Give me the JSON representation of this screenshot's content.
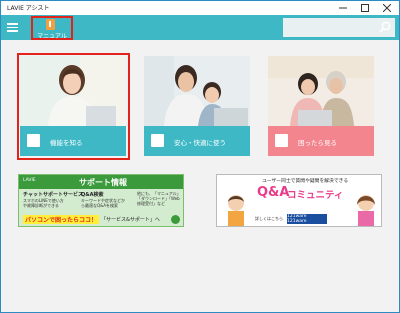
{
  "window": {
    "title": "LAVIE アシスト"
  },
  "header": {
    "manual_label": "マニュアル"
  },
  "tiles": [
    {
      "label": "機能を知る"
    },
    {
      "label": "安心・快適に使う"
    },
    {
      "label": "困ったら見る"
    }
  ],
  "banner_support": {
    "logo": "LAVIE",
    "title": "サポート情報",
    "col1_title": "チャットサポートサービス",
    "col1_text": "スマホのLINEで使い方や故障診断ができる",
    "col2_title": "Q&A検索",
    "col2_text": "キーワードや症状などから最適なQ&Aを検索",
    "col3_text": "他にも、「マニュアル」「ダウンロード」「Web修理受付」など",
    "footer_highlight": "パソコンで困ったらココ！",
    "footer_link": "「サービス&サポート」へ"
  },
  "banner_community": {
    "tagline": "ユーザー同士で質問や疑問を解決できる",
    "qa": "Q&A",
    "title": "コミュニティ",
    "footer_text": "詳しくはこちら",
    "footer_brand": "121ware 121ware"
  }
}
